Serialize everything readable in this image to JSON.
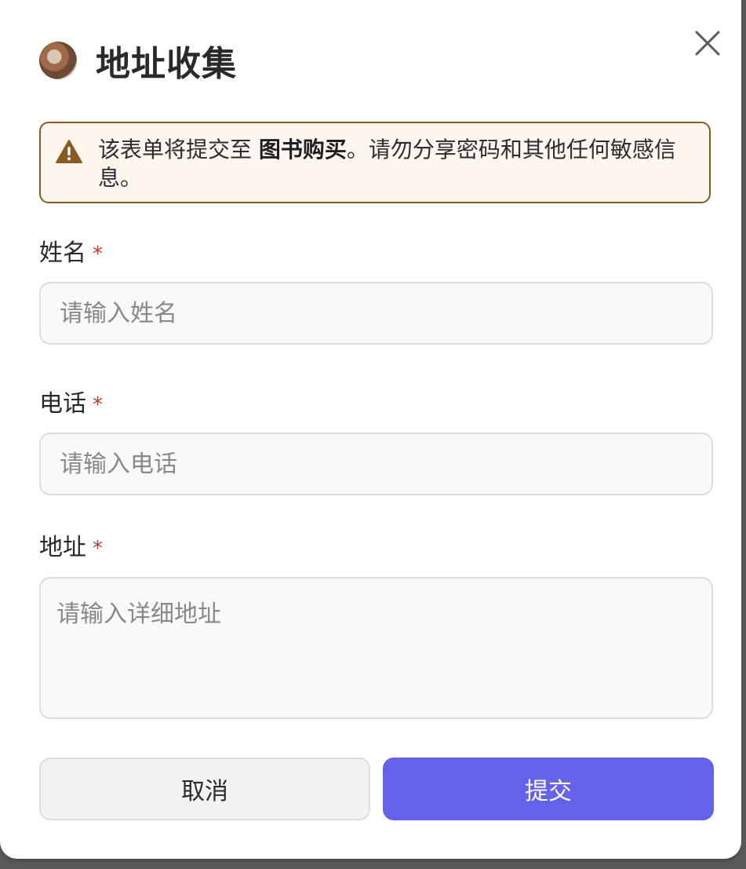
{
  "dialog": {
    "title": "地址收集",
    "close_icon": "close-icon",
    "avatar_icon": "avatar-image"
  },
  "alert": {
    "icon": "warning-icon",
    "text_before": "该表单将提交至 ",
    "app_name": "图书购买",
    "text_after": "。请勿分享密码和其他任何敏感信息。"
  },
  "fields": {
    "name": {
      "label": "姓名",
      "required_mark": "*",
      "placeholder": "请输入姓名",
      "value": ""
    },
    "phone": {
      "label": "电话",
      "required_mark": "*",
      "placeholder": "请输入电话",
      "value": ""
    },
    "address": {
      "label": "地址",
      "required_mark": "*",
      "placeholder": "请输入详细地址",
      "value": ""
    }
  },
  "buttons": {
    "cancel_label": "取消",
    "submit_label": "提交"
  },
  "colors": {
    "accent": "#6561e8",
    "warning": "#8a5b20",
    "warning_bg": "#fcf6ee",
    "required": "#c0392b"
  }
}
